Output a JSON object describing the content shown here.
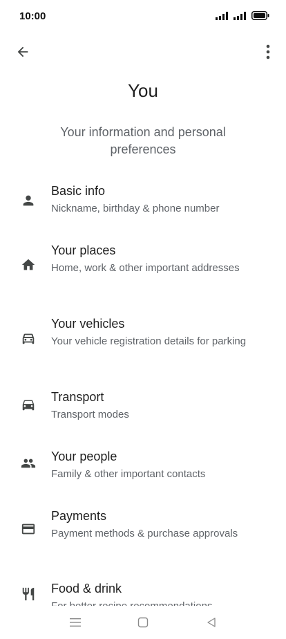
{
  "status": {
    "time": "10:00"
  },
  "page": {
    "title": "You",
    "subtitle": "Your information and personal preferences"
  },
  "items": [
    {
      "title": "Basic info",
      "description": "Nickname, birthday & phone number",
      "icon": "person-icon"
    },
    {
      "title": "Your places",
      "description": "Home, work & other important addresses",
      "icon": "home-icon"
    },
    {
      "title": "Your vehicles",
      "description": "Your vehicle registration details for parking",
      "icon": "car-icon"
    },
    {
      "title": "Transport",
      "description": "Transport modes",
      "icon": "car-icon"
    },
    {
      "title": "Your people",
      "description": "Family & other important contacts",
      "icon": "people-icon"
    },
    {
      "title": "Payments",
      "description": "Payment methods & purchase approvals",
      "icon": "credit-card-icon"
    },
    {
      "title": "Food & drink",
      "description": "For better recipe recommendations",
      "icon": "restaurant-icon"
    }
  ],
  "colors": {
    "text": "#1f1f1f",
    "secondary": "#5f6368",
    "icon": "#444746"
  }
}
